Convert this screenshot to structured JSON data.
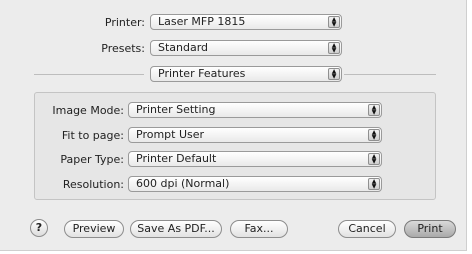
{
  "printer": {
    "label": "Printer:",
    "value": "Laser MFP 1815"
  },
  "presets": {
    "label": "Presets:",
    "value": "Standard"
  },
  "pane_selector": {
    "value": "Printer Features"
  },
  "features": [
    {
      "label": "Image Mode:",
      "value": "Printer Setting"
    },
    {
      "label": "Fit to page:",
      "value": "Prompt User"
    },
    {
      "label": "Paper Type:",
      "value": "Printer Default"
    },
    {
      "label": "Resolution:",
      "value": "600 dpi (Normal)"
    }
  ],
  "buttons": {
    "help": "?",
    "preview": "Preview",
    "save_pdf": "Save As PDF...",
    "fax": "Fax...",
    "cancel": "Cancel",
    "print": "Print"
  },
  "icons": {
    "popup_arrows": "updown-arrows-icon",
    "help": "question-mark-icon"
  }
}
